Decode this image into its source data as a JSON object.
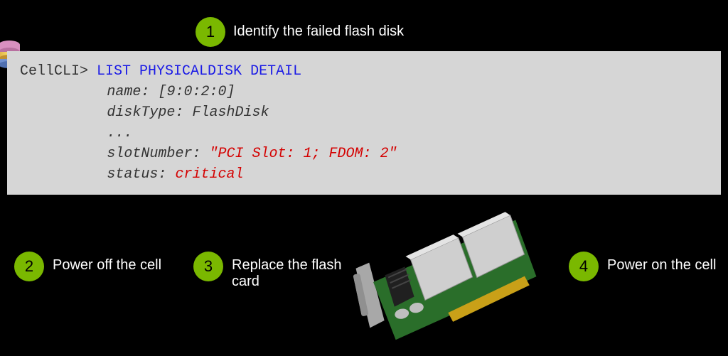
{
  "steps": {
    "s1": {
      "num": "1",
      "caption": "Identify the failed flash disk"
    },
    "s2": {
      "num": "2",
      "caption": "Power off the cell"
    },
    "s3": {
      "num": "3",
      "caption": "Replace the flash card"
    },
    "s4": {
      "num": "4",
      "caption": "Power on the cell"
    }
  },
  "terminal": {
    "prompt": "CellCLI>",
    "command": "LIST PHYSICALDISK DETAIL",
    "lines": {
      "name_label": "name:",
      "name_value": "[9:0:2:0]",
      "diskType_label": "diskType:",
      "diskType_value": "FlashDisk",
      "ellipsis": "...",
      "slotNumber_label": "slotNumber:",
      "slotNumber_value": "\"PCI Slot: 1; FDOM: 2\"",
      "status_label": "status:",
      "status_value": "critical"
    }
  },
  "icons": {
    "db": "database-icon",
    "card": "flash-card-illustration"
  }
}
